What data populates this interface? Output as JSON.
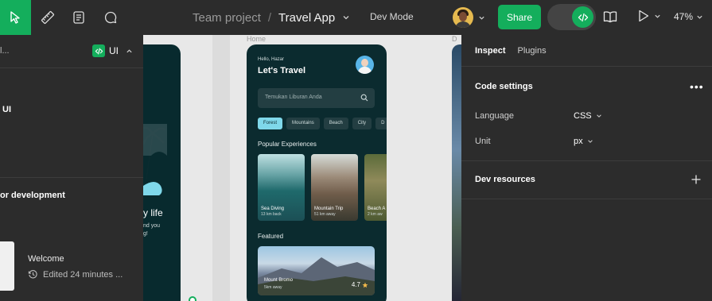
{
  "toolbar": {
    "project": "Team project",
    "separator": "/",
    "file": "Travel App",
    "mode": "Dev Mode",
    "share_label": "Share",
    "zoom": "47%"
  },
  "left_panel": {
    "truncated_label": "l...",
    "ui_label": "UI",
    "ui_section": "UI",
    "dev_label": "or development",
    "welcome_title": "Welcome",
    "welcome_edited": "Edited 24 minutes ..."
  },
  "canvas": {
    "home_label": "Home",
    "right_frame_label": "D",
    "left_frame": {
      "headline": "y life",
      "body_line1": "nd you",
      "body_line2": "g!"
    },
    "home": {
      "greeting": "Hello, Hazar",
      "title": "Let's Travel",
      "search_placeholder": "Temukan Liburan Anda",
      "chips": [
        "Forest",
        "Mountains",
        "Beach",
        "City",
        "D"
      ],
      "popular_title": "Popular Experiences",
      "cards": [
        {
          "name": "Sea Diving",
          "distance": "13 km back"
        },
        {
          "name": "Mountain Trip",
          "distance": "51 km away"
        },
        {
          "name": "Beach A",
          "distance": "2 km aw"
        }
      ],
      "featured_title": "Featured",
      "featured": {
        "name": "Mount Bromo",
        "distance": "5km away",
        "rating": "4.7"
      }
    }
  },
  "right_panel": {
    "tabs": [
      "Inspect",
      "Plugins"
    ],
    "code_settings": "Code settings",
    "more": "•••",
    "language_label": "Language",
    "language_value": "CSS",
    "unit_label": "Unit",
    "unit_value": "px",
    "dev_resources": "Dev resources"
  },
  "colors": {
    "accent": "#14ae5c",
    "panel": "#2c2c2c",
    "frame": "#0b2b2f",
    "chip_active": "#7fd8ea"
  }
}
